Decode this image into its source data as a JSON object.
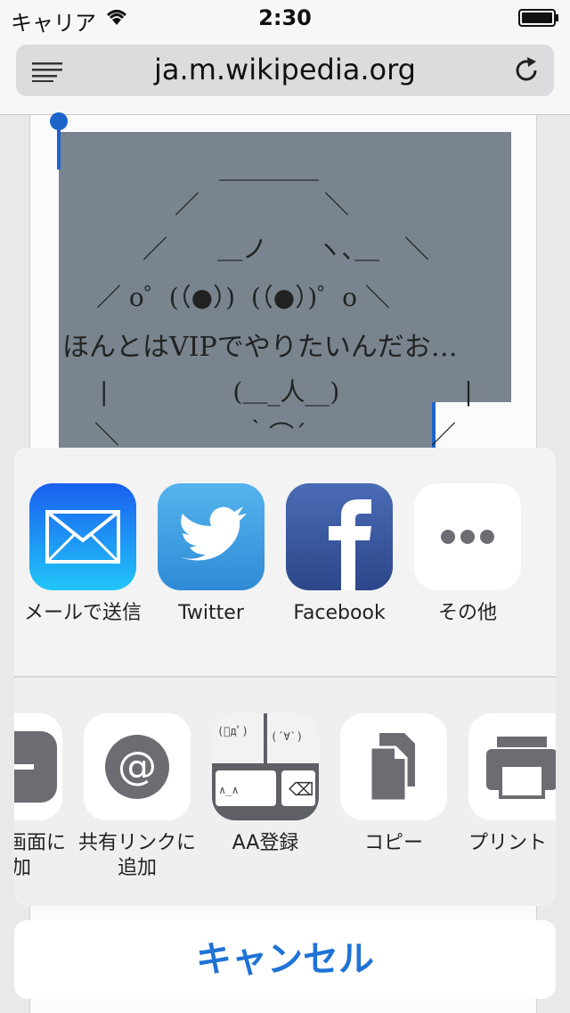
{
  "status": {
    "carrier": "キャリア",
    "time": "2:30"
  },
  "browser": {
    "url": "ja.m.wikipedia.org"
  },
  "ascii_art": {
    "line1": "＿＿＿＿",
    "line2": "／　　　　　＼",
    "line3": "／　　＿ノ　　ヽ､＿　＼",
    "line4": "／ o゜(（●）)  (（●）)゜o ＼",
    "line5": "ほんとはVIPでやりたいんだお…",
    "line6": "|　　　　　(＿_人__)　　　　　|",
    "line7": "＼　　　　　｀⌒´　　　　　／"
  },
  "share_sheet": {
    "apps": [
      {
        "name": "メールで送信",
        "icon": "mail-icon",
        "color": "#1a7ef5"
      },
      {
        "name": "Twitter",
        "icon": "twitter-icon",
        "color": "#3b9be0"
      },
      {
        "name": "Facebook",
        "icon": "facebook-icon",
        "color": "#3a5aa0"
      },
      {
        "name": "その他",
        "icon": "more-icon"
      }
    ],
    "actions": [
      {
        "name_line1": "画面に",
        "name_line2": "加",
        "icon": "add-to-home-icon"
      },
      {
        "name_line1": "共有リンクに",
        "name_line2": "追加",
        "icon": "at-icon"
      },
      {
        "name_line1": "AA登録",
        "icon": "aa-keyboard-icon"
      },
      {
        "name_line1": "コピー",
        "icon": "copy-icon"
      },
      {
        "name_line1": "プリント",
        "icon": "print-icon"
      }
    ]
  },
  "cancel_label": "キャンセル"
}
